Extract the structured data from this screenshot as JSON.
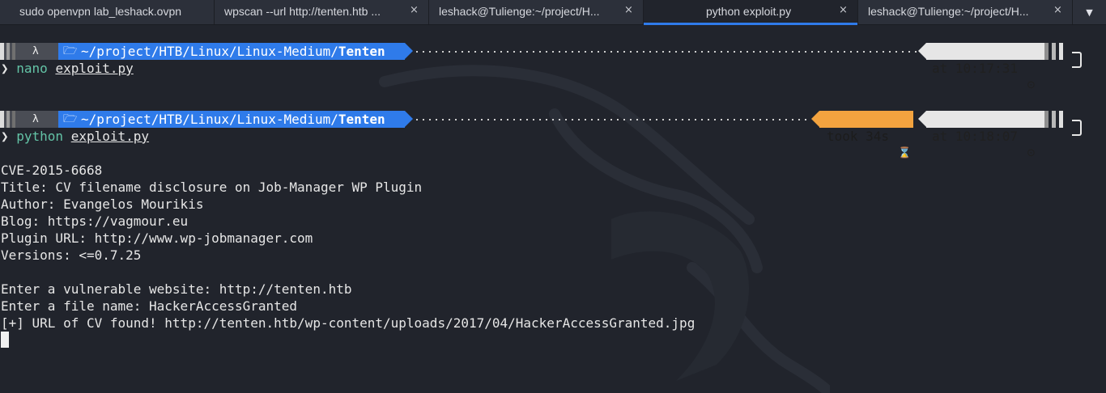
{
  "tabs": [
    {
      "label": "sudo openvpn lab_leshack.ovpn",
      "active": false
    },
    {
      "label": "wpscan --url http://tenten.htb ...",
      "active": false
    },
    {
      "label": "leshack@Tulienge:~/project/H...",
      "active": false
    },
    {
      "label": "python exploit.py",
      "active": true
    },
    {
      "label": "leshack@Tulienge:~/project/H...",
      "active": false
    }
  ],
  "tab_close_icon": "×",
  "tab_menu_icon": "▼",
  "prompts": [
    {
      "os_icon": "λ",
      "folder_icon": "🗁",
      "dir_prefix": "~/project/HTB/Linux/Linux-Medium/",
      "dir_last": "Tenten",
      "time_text": "at 10:17:31",
      "clock_icon": "⊙",
      "prompt_char": "❯ ",
      "command": "nano",
      "argument": "exploit.py"
    },
    {
      "os_icon": "λ",
      "folder_icon": "🗁",
      "dir_prefix": "~/project/HTB/Linux/Linux-Medium/",
      "dir_last": "Tenten",
      "took_text": "took 34s",
      "hourglass_icon": "⌛",
      "time_text": "at 10:18:07",
      "clock_icon": "⊙",
      "prompt_char": "❯ ",
      "command": "python",
      "argument": "exploit.py"
    }
  ],
  "output": [
    "CVE-2015-6668",
    "Title: CV filename disclosure on Job-Manager WP Plugin",
    "Author: Evangelos Mourikis",
    "Blog: https://vagmour.eu",
    "Plugin URL: http://www.wp-jobmanager.com",
    "Versions: <=0.7.25",
    "",
    "Enter a vulnerable website: http://tenten.htb",
    "Enter a file name: HackerAccessGranted",
    "[+] URL of CV found! http://tenten.htb/wp-content/uploads/2017/04/HackerAccessGranted.jpg"
  ],
  "colors": {
    "background": "#21242c",
    "dir_segment": "#2f7bea",
    "took_segment": "#f3a33f",
    "time_segment": "#e6e6e6",
    "command": "#63c3a6",
    "active_tab_indicator": "#2f7bea"
  }
}
